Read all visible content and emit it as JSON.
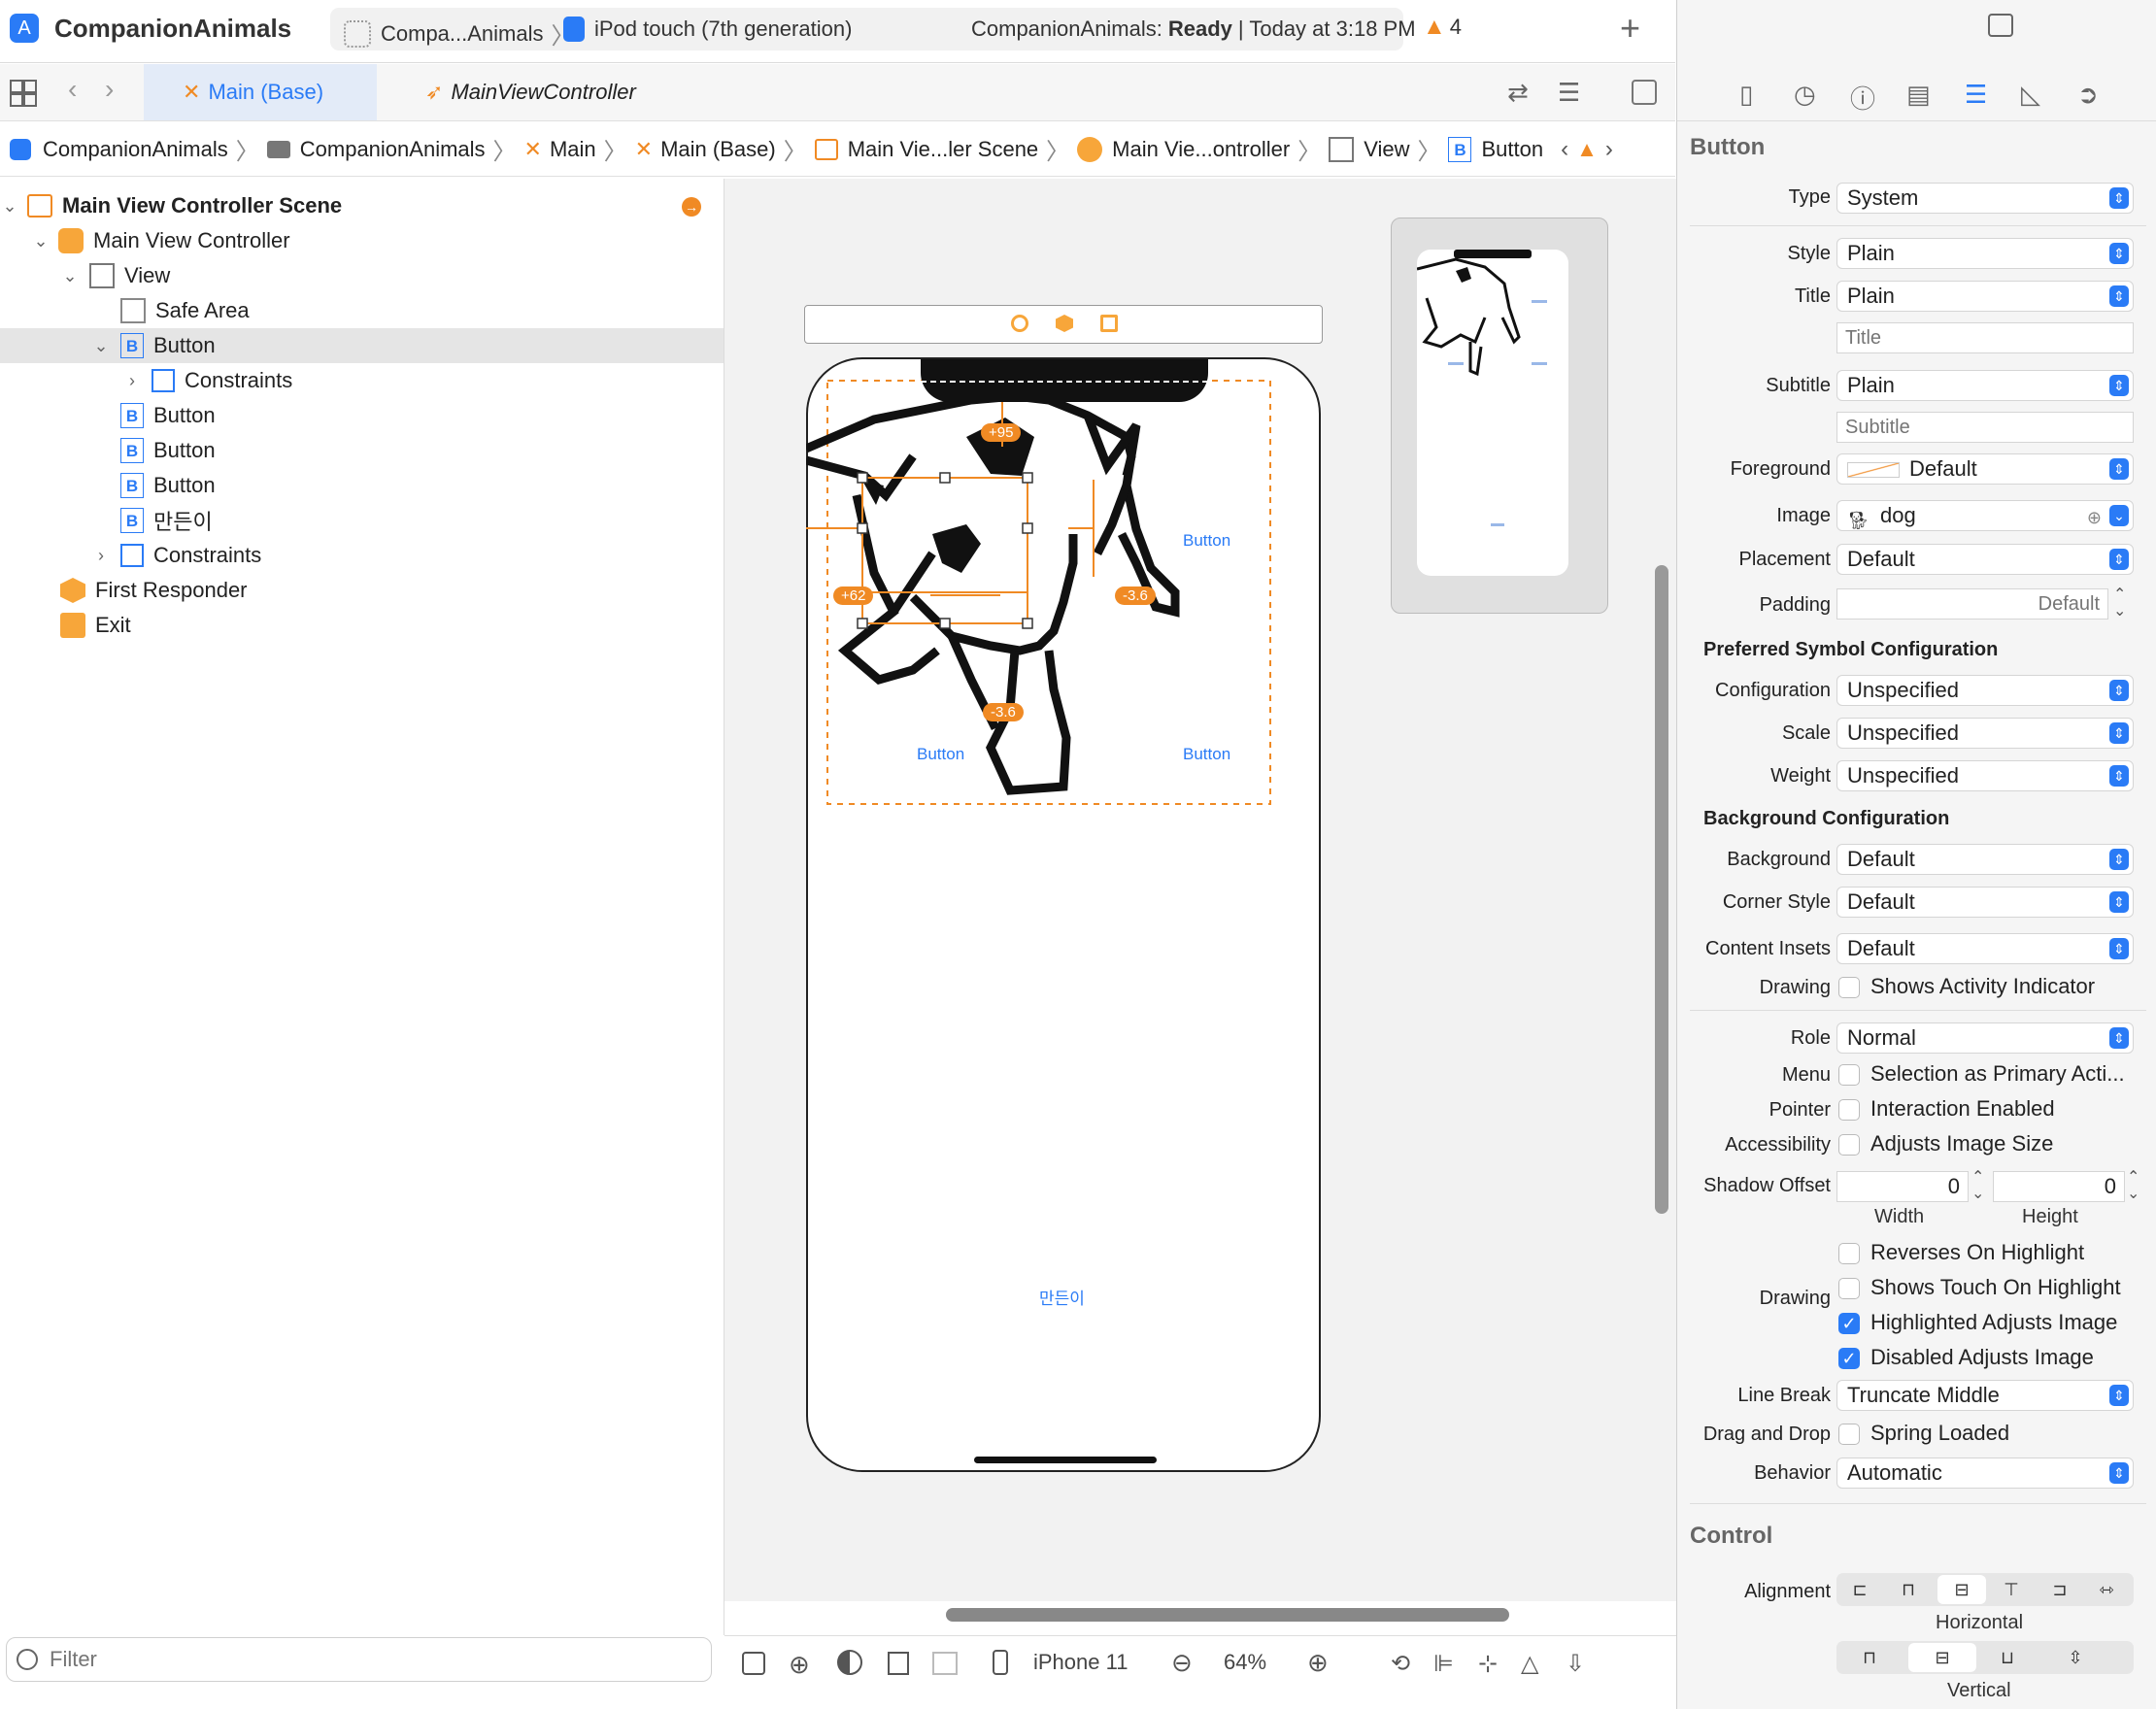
{
  "toolbar": {
    "app_name": "CompanionAnimals",
    "scheme": "Compa...Animals",
    "device": "iPod touch (7th generation)",
    "status_app": "CompanionAnimals:",
    "status_state": "Ready",
    "status_time": "| Today at 3:18 PM",
    "warning_count": "4",
    "add_label": "+"
  },
  "tabs": [
    {
      "label": "Main (Base)"
    },
    {
      "label": "MainViewController"
    }
  ],
  "breadcrumb": [
    "CompanionAnimals",
    "CompanionAnimals",
    "Main",
    "Main (Base)",
    "Main Vie...ler Scene",
    "Main Vie...ontroller",
    "View",
    "Button"
  ],
  "outline": [
    {
      "label": "Main View Controller Scene",
      "bold": true
    },
    {
      "label": "Main View Controller"
    },
    {
      "label": "View"
    },
    {
      "label": "Safe Area"
    },
    {
      "label": "Button"
    },
    {
      "label": "Constraints"
    },
    {
      "label": "Button"
    },
    {
      "label": "Button"
    },
    {
      "label": "Button"
    },
    {
      "label": "만든이"
    },
    {
      "label": "Constraints"
    },
    {
      "label": "First Responder"
    },
    {
      "label": "Exit"
    }
  ],
  "filter": {
    "placeholder": "Filter"
  },
  "canvas": {
    "buttons": [
      "Button",
      "Button",
      "Button",
      "만든이"
    ],
    "constraints": [
      "+95",
      "+62",
      "-3.6",
      "-3.6"
    ],
    "device_name": "iPhone 11",
    "zoom": "64%"
  },
  "inspector": {
    "header": "Button",
    "type_label": "Type",
    "type_value": "System",
    "style_label": "Style",
    "style_value": "Plain",
    "title_label": "Title",
    "title_value": "Plain",
    "title_placeholder": "Title",
    "subtitle_label": "Subtitle",
    "subtitle_value": "Plain",
    "subtitle_placeholder": "Subtitle",
    "foreground_label": "Foreground",
    "foreground_value": "Default",
    "image_label": "Image",
    "image_value": "dog",
    "placement_label": "Placement",
    "placement_value": "Default",
    "padding_label": "Padding",
    "padding_placeholder": "Default",
    "symbol_section": "Preferred Symbol Configuration",
    "configuration_label": "Configuration",
    "configuration_value": "Unspecified",
    "scale_label": "Scale",
    "scale_value": "Unspecified",
    "weight_label": "Weight",
    "weight_value": "Unspecified",
    "background_section": "Background Configuration",
    "background_label": "Background",
    "background_value": "Default",
    "corner_label": "Corner Style",
    "corner_value": "Default",
    "insets_label": "Content Insets",
    "insets_value": "Default",
    "drawing_label": "Drawing",
    "drawing_option": "Shows Activity Indicator",
    "role_label": "Role",
    "role_value": "Normal",
    "menu_label": "Menu",
    "menu_option": "Selection as Primary Acti...",
    "pointer_label": "Pointer",
    "pointer_option": "Interaction Enabled",
    "accessibility_label": "Accessibility",
    "accessibility_option": "Adjusts Image Size",
    "shadow_label": "Shadow Offset",
    "shadow_width": "0",
    "shadow_height": "0",
    "width_label": "Width",
    "height_label": "Height",
    "reverses_option": "Reverses On Highlight",
    "drawing2_label": "Drawing",
    "touch_option": "Shows Touch On Highlight",
    "highlighted_option": "Highlighted Adjusts Image",
    "disabled_option": "Disabled Adjusts Image",
    "linebreak_label": "Line Break",
    "linebreak_value": "Truncate Middle",
    "drag_label": "Drag and Drop",
    "drag_option": "Spring Loaded",
    "behavior_label": "Behavior",
    "behavior_value": "Automatic",
    "control_section": "Control",
    "alignment_label": "Alignment",
    "horizontal_label": "Horizontal",
    "vertical_label": "Vertical"
  },
  "colors": {
    "accent": "#2a7bf6",
    "constraint": "#f08a24",
    "warning": "#f08a24"
  }
}
